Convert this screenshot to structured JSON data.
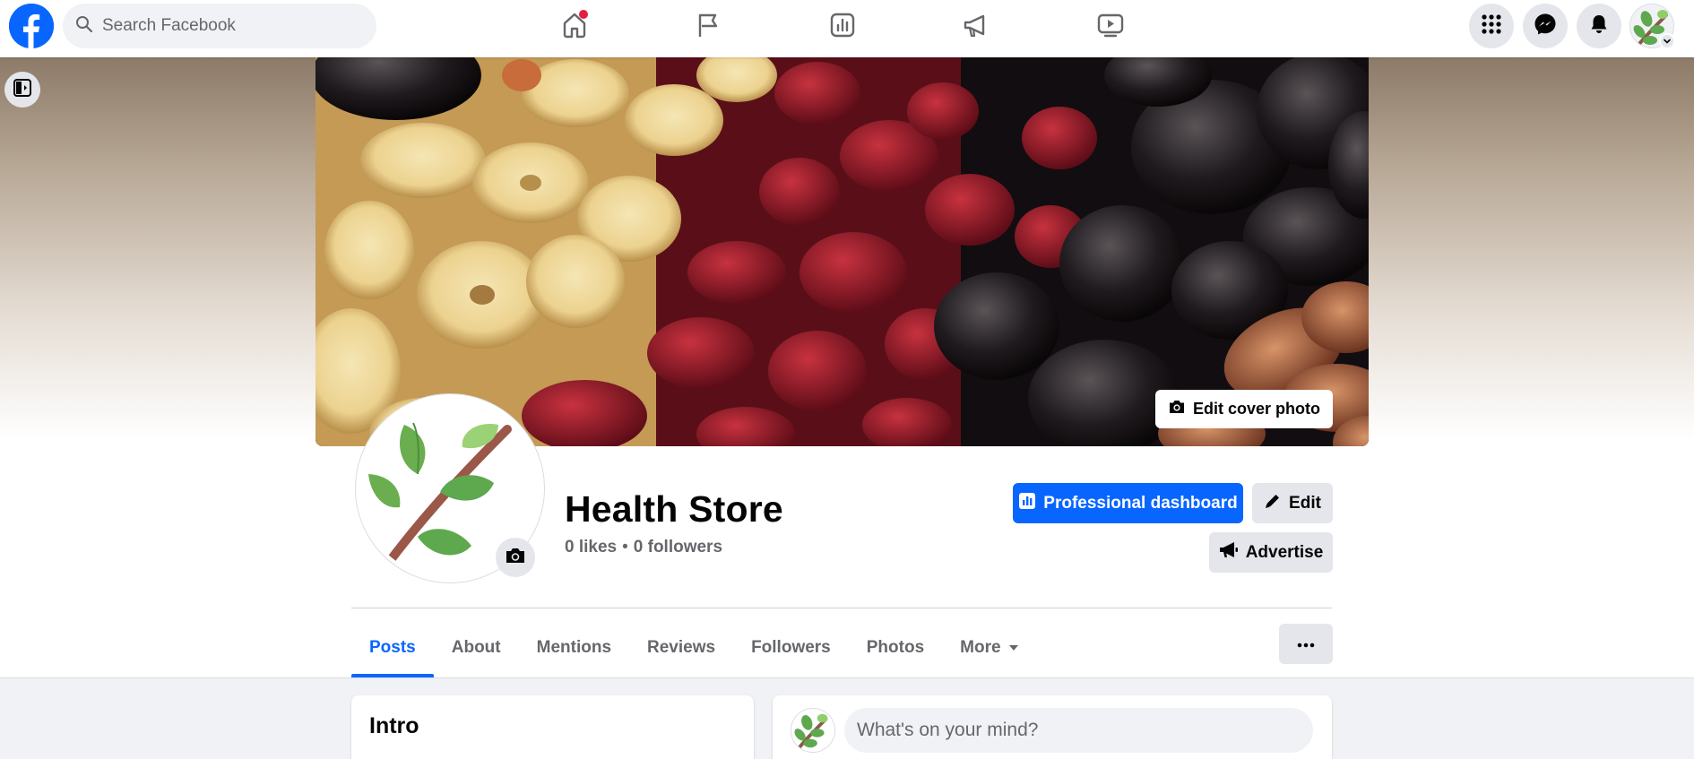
{
  "topbar": {
    "search_placeholder": "Search Facebook",
    "nav_icons": [
      "home-icon",
      "flag-icon",
      "insights-icon",
      "megaphone-icon",
      "video-icon"
    ],
    "right_icons": [
      "menu-grid-icon",
      "messenger-icon",
      "bell-icon"
    ],
    "home_notification": true
  },
  "cover": {
    "edit_cover_label": "Edit cover photo"
  },
  "profile": {
    "name": "Health Store",
    "likes": "0 likes",
    "separator": "•",
    "followers": "0 followers"
  },
  "actions": {
    "dashboard_label": "Professional dashboard",
    "edit_label": "Edit",
    "advertise_label": "Advertise"
  },
  "tabs": [
    {
      "label": "Posts",
      "active": true
    },
    {
      "label": "About",
      "active": false
    },
    {
      "label": "Mentions",
      "active": false
    },
    {
      "label": "Reviews",
      "active": false
    },
    {
      "label": "Followers",
      "active": false
    },
    {
      "label": "Photos",
      "active": false
    },
    {
      "label": "More",
      "active": false
    }
  ],
  "intro": {
    "title": "Intro"
  },
  "composer": {
    "placeholder": "What's on your mind?"
  },
  "colors": {
    "brand": "#0866ff",
    "notification": "#e41e3f",
    "secondary_bg": "#e4e6eb",
    "muted_text": "#65676b"
  }
}
